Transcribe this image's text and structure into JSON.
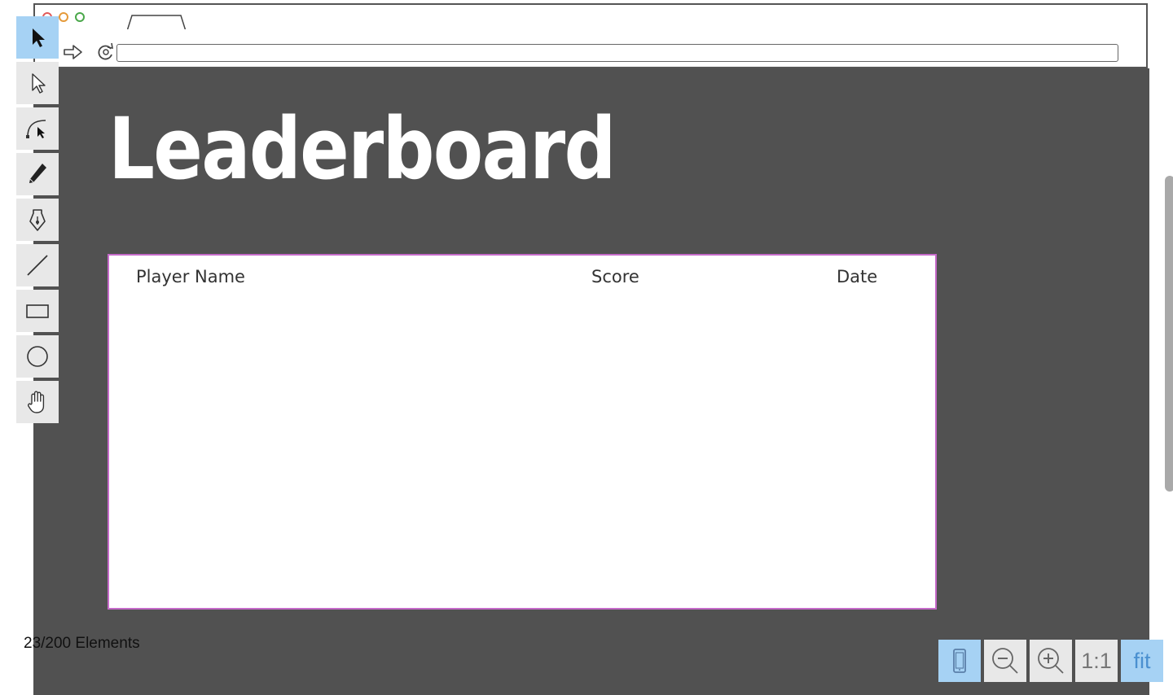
{
  "mockup": {
    "title": "Leaderboard",
    "table": {
      "columns": [
        "Player Name",
        "Score",
        "Date"
      ],
      "rows": []
    }
  },
  "toolbar": {
    "tools": [
      {
        "name": "select-tool",
        "icon": "arrow-filled-icon",
        "active": true
      },
      {
        "name": "direct-select-tool",
        "icon": "arrow-outline-icon",
        "active": false
      },
      {
        "name": "bezier-tool",
        "icon": "bezier-curve-icon",
        "active": false
      },
      {
        "name": "pencil-tool",
        "icon": "pencil-icon",
        "active": false
      },
      {
        "name": "pen-tool",
        "icon": "pen-nib-icon",
        "active": false
      },
      {
        "name": "line-tool",
        "icon": "line-icon",
        "active": false
      },
      {
        "name": "rectangle-tool",
        "icon": "rectangle-icon",
        "active": false
      },
      {
        "name": "ellipse-tool",
        "icon": "ellipse-icon",
        "active": false
      },
      {
        "name": "hand-tool",
        "icon": "hand-icon",
        "active": false
      }
    ]
  },
  "status": {
    "elements_count": "23/200 Elements"
  },
  "zoom": {
    "one_to_one_label": "1:1",
    "fit_label": "fit"
  },
  "colors": {
    "canvas_bg": "#515151",
    "table_border": "#c56ac9",
    "active_tool": "#a6d2f4"
  }
}
